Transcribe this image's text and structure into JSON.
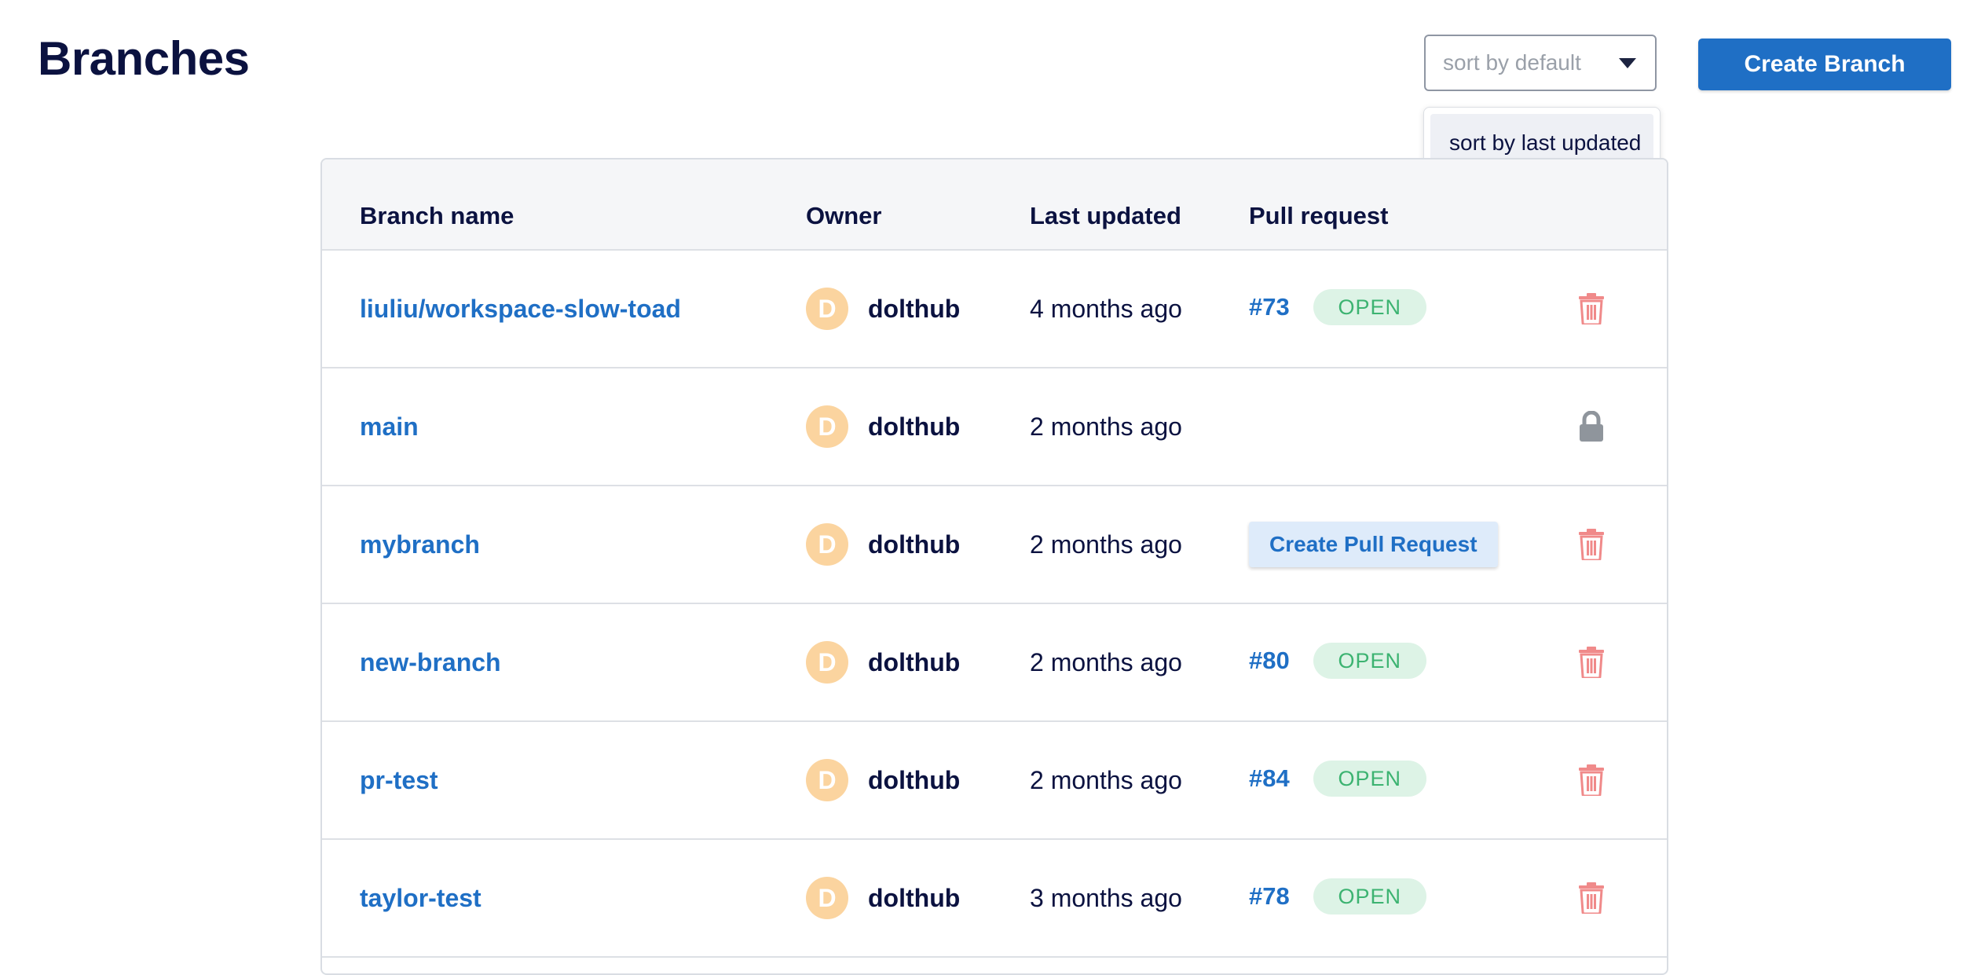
{
  "page": {
    "title": "Branches"
  },
  "sort": {
    "selected_placeholder": "sort by default",
    "options": [
      "sort by last updated"
    ]
  },
  "toolbar": {
    "create_branch_label": "Create Branch"
  },
  "table": {
    "headers": {
      "branch_name": "Branch name",
      "owner": "Owner",
      "last_updated": "Last updated",
      "pull_request": "Pull request"
    },
    "rows": [
      {
        "branch": "liuliu/workspace-slow-toad",
        "owner_initial": "D",
        "owner": "dolthub",
        "updated": "4 months ago",
        "pr_number": "#73",
        "pr_status": "OPEN",
        "action_icon": "trash-icon"
      },
      {
        "branch": "main",
        "owner_initial": "D",
        "owner": "dolthub",
        "updated": "2 months ago",
        "action_icon": "lock-icon"
      },
      {
        "branch": "mybranch",
        "owner_initial": "D",
        "owner": "dolthub",
        "updated": "2 months ago",
        "pr_button": "Create Pull Request",
        "action_icon": "trash-icon"
      },
      {
        "branch": "new-branch",
        "owner_initial": "D",
        "owner": "dolthub",
        "updated": "2 months ago",
        "pr_number": "#80",
        "pr_status": "OPEN",
        "action_icon": "trash-icon"
      },
      {
        "branch": "pr-test",
        "owner_initial": "D",
        "owner": "dolthub",
        "updated": "2 months ago",
        "pr_number": "#84",
        "pr_status": "OPEN",
        "action_icon": "trash-icon"
      },
      {
        "branch": "taylor-test",
        "owner_initial": "D",
        "owner": "dolthub",
        "updated": "3 months ago",
        "pr_number": "#78",
        "pr_status": "OPEN",
        "action_icon": "trash-icon"
      }
    ]
  },
  "colors": {
    "accent": "#1f6fc5",
    "title": "#0b1240",
    "open_badge_bg": "#ddf3e6",
    "open_badge_text": "#3cb371",
    "delete_icon": "#f08a8a",
    "lock_icon": "#8f959c",
    "avatar": "#fbd49f"
  }
}
